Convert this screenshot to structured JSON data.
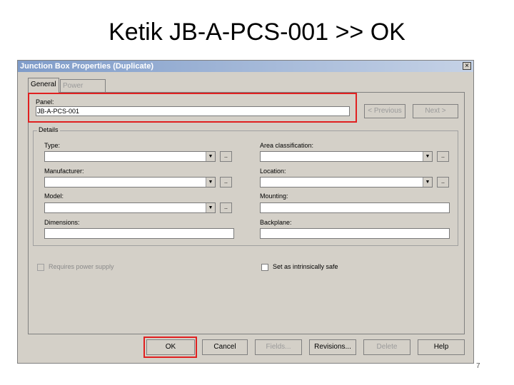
{
  "slide": {
    "title": "Ketik JB-A-PCS-001 >> OK",
    "page_number": "7"
  },
  "dialog": {
    "title": "Junction Box Properties (Duplicate)",
    "close_label": "×",
    "tabs": [
      {
        "label": "General"
      },
      {
        "label": "Power Supply"
      }
    ],
    "panel": {
      "label": "Panel:",
      "value": "JB-A-PCS-001",
      "previous_label": "< Previous",
      "next_label": "Next >"
    },
    "details": {
      "legend": "Details",
      "type_label": "Type:",
      "manufacturer_label": "Manufacturer:",
      "model_label": "Model:",
      "dimensions_label": "Dimensions:",
      "area_classification_label": "Area classification:",
      "location_label": "Location:",
      "mounting_label": "Mounting:",
      "backplane_label": "Backplane:",
      "dots_label": "..",
      "arrow": "▼"
    },
    "checkboxes": {
      "requires_power_supply": "Requires power supply",
      "set_as_intrinsically_safe": "Set as intrinsically safe"
    },
    "buttons": {
      "ok": "OK",
      "cancel": "Cancel",
      "fields": "Fields...",
      "revisions": "Revisions...",
      "delete": "Delete",
      "help": "Help"
    }
  },
  "colors": {
    "highlight": "#e02020",
    "dialog_bg": "#d4d0c8",
    "titlebar": "#7f9cc9"
  }
}
